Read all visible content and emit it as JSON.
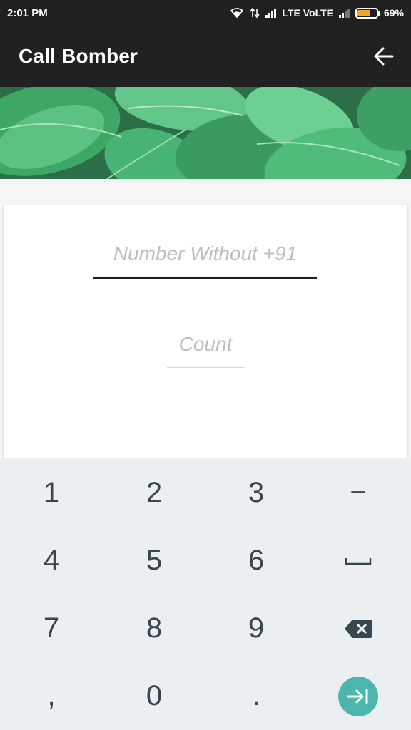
{
  "status_bar": {
    "time": "2:01 PM",
    "network": "LTE VoLTE",
    "battery": "69%",
    "battery_level": 0.69
  },
  "app_bar": {
    "title": "Call Bomber",
    "back_icon": "arrow-left-icon"
  },
  "banner": {
    "description_icon": "leaf-banner-image"
  },
  "form": {
    "number_placeholder": "Number Without +91",
    "count_placeholder": "Count"
  },
  "keyboard": {
    "keys": [
      "1",
      "2",
      "3",
      "−",
      "4",
      "5",
      "6",
      "",
      "7",
      "8",
      "9",
      "",
      ",",
      "0",
      ".",
      ""
    ],
    "space_icon": "space-bar-icon",
    "backspace_icon": "backspace-icon",
    "enter_icon": "tab-enter-icon",
    "accent_color": "#4db6ac"
  }
}
